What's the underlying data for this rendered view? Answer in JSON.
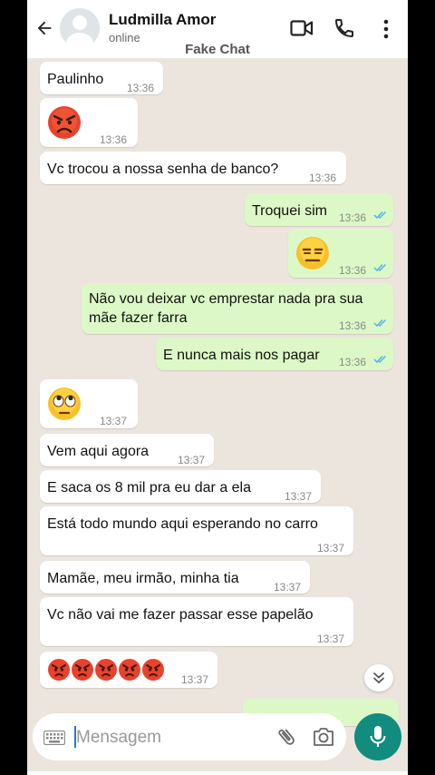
{
  "header": {
    "contact_name": "Ludmilla Amor",
    "status": "online",
    "subtitle": "Fake Chat"
  },
  "messages": [
    {
      "dir": "in",
      "text": "Paulinho",
      "time": "13:36"
    },
    {
      "dir": "in",
      "emoji": "angry-face",
      "time": "13:36"
    },
    {
      "dir": "in",
      "text": "Vc trocou a nossa senha de banco?",
      "time": "13:36"
    },
    {
      "dir": "out",
      "text": "Troquei sim",
      "time": "13:36",
      "read": true
    },
    {
      "dir": "out",
      "emoji": "expressionless-face",
      "time": "13:36",
      "read": true
    },
    {
      "dir": "out",
      "text_line1": "Não vou deixar vc emprestar nada pra sua",
      "text_line2": "mãe fazer farra",
      "time": "13:36",
      "read": true
    },
    {
      "dir": "out",
      "text": "E nunca mais nos pagar",
      "time": "13:36",
      "read": true
    },
    {
      "dir": "in",
      "emoji": "face-with-rolling-eyes",
      "time": "13:37"
    },
    {
      "dir": "in",
      "text": "Vem aqui agora",
      "time": "13:37"
    },
    {
      "dir": "in",
      "text": "E saca os 8 mil pra eu dar a ela",
      "time": "13:37"
    },
    {
      "dir": "in",
      "text": "Está todo mundo aqui esperando no carro",
      "time": "13:37"
    },
    {
      "dir": "in",
      "text": "Mamãe, meu irmão, minha tia",
      "time": "13:37"
    },
    {
      "dir": "in",
      "text": "Vc não vai me fazer passar esse papelão",
      "time": "13:37"
    },
    {
      "dir": "in",
      "emoji": "angry-face x5",
      "time": "13:37"
    }
  ],
  "composer": {
    "placeholder": "Mensagem"
  },
  "colors": {
    "incoming": "#ffffff",
    "outgoing": "#dcf8c6",
    "accent": "#128c7e",
    "read_tick": "#4fb6ec",
    "background": "#ece5dd"
  }
}
